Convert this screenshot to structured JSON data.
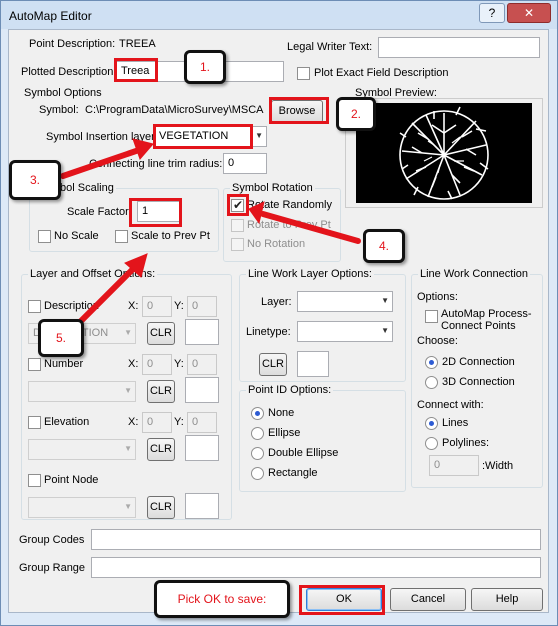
{
  "window": {
    "title": "AutoMap Editor",
    "help_icon": "?",
    "close_icon": "✕"
  },
  "point_description": {
    "label": "Point Description:",
    "value": "TREEA"
  },
  "plotted_description": {
    "label": "Plotted Description:",
    "value": "Treea",
    "extra": ""
  },
  "legal_writer": {
    "label": "Legal Writer Text:",
    "value": ""
  },
  "plot_exact": {
    "label": "Plot Exact Field Description",
    "checked": false
  },
  "symbol_options": {
    "title": "Symbol Options",
    "symbol_label": "Symbol:",
    "symbol_path": "C:\\ProgramData\\MicroSurvey\\MSCA",
    "browse": "Browse",
    "insertion_label": "Symbol Insertion layer:",
    "insertion_value": "VEGETATION",
    "trim_label": "Connecting line trim radius:",
    "trim_value": "0"
  },
  "symbol_preview": {
    "title": "Symbol Preview:"
  },
  "symbol_scaling": {
    "title": "Symbol Scaling",
    "scale_factor_label": "Scale Factor:",
    "scale_factor_value": "1",
    "no_scale": "No Scale",
    "scale_prev": "Scale to Prev Pt"
  },
  "symbol_rotation": {
    "title": "Symbol Rotation",
    "rotate_randomly": "Rotate Randomly",
    "rotate_prev": "Rotate to Prev Pt",
    "no_rotation": "No Rotation",
    "rotate_randomly_checked": true
  },
  "layer_offset": {
    "title": "Layer and Offset Options:",
    "x": "X:",
    "y": "Y:",
    "clr": "CLR",
    "rows": [
      {
        "label": "Description",
        "layer": "DESCRIPTION",
        "x": "0",
        "y": "0"
      },
      {
        "label": "Number",
        "layer": "",
        "x": "0",
        "y": "0"
      },
      {
        "label": "Elevation",
        "layer": "",
        "x": "0",
        "y": "0"
      },
      {
        "label": "Point Node",
        "layer": ""
      }
    ]
  },
  "line_work_layer": {
    "title": "Line Work Layer Options:",
    "layer_label": "Layer:",
    "linetype_label": "Linetype:",
    "clr": "CLR"
  },
  "point_id": {
    "title": "Point ID Options:",
    "options": [
      "None",
      "Ellipse",
      "Double Ellipse",
      "Rectangle"
    ],
    "selected": "None"
  },
  "line_work_connection": {
    "title": "Line Work Connection",
    "options_label": "Options:",
    "automap_process": "AutoMap Process-Connect Points",
    "choose_label": "Choose:",
    "choose_options": [
      "2D Connection",
      "3D Connection"
    ],
    "choose_selected": "2D Connection",
    "connect_with_label": "Connect with:",
    "connect_options": [
      "Lines",
      "Polylines:"
    ],
    "connect_selected": "Lines",
    "width_value": "0",
    "width_label": ":Width"
  },
  "group_codes": {
    "label": "Group Codes",
    "value": ""
  },
  "group_range": {
    "label": "Group Range",
    "value": ""
  },
  "buttons": {
    "ok": "OK",
    "cancel": "Cancel",
    "help": "Help"
  },
  "callouts": {
    "c1": "1.",
    "c2": "2.",
    "c3": "3.",
    "c4": "4.",
    "c5": "5.",
    "save_note": "Pick OK to save:"
  },
  "colors": {
    "callout_red": "#e3141b",
    "dialog_bg": "#f0f0f0",
    "titlebar": "#cfe0f3",
    "preview_bg": "#000000"
  }
}
